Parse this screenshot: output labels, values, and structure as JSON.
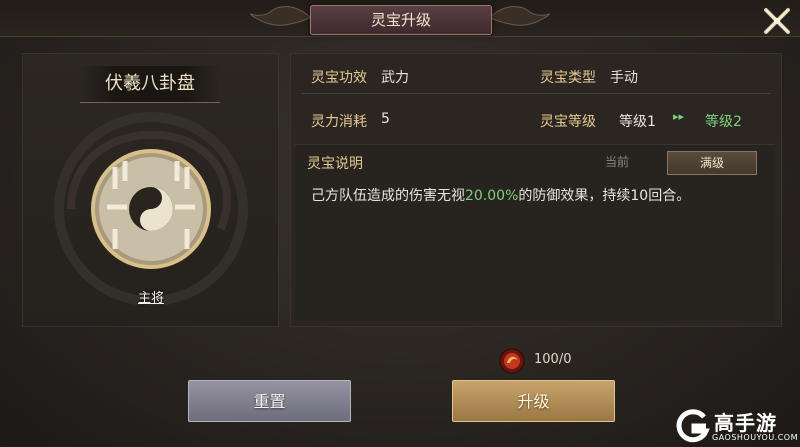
{
  "dialog": {
    "title": "灵宝升级",
    "close_icon": "close-x-icon"
  },
  "artifact": {
    "name": "伏羲八卦盘",
    "icon": "bagua-yin-yang-icon",
    "tag": "主将"
  },
  "attributes": {
    "effect_label": "灵宝功效",
    "effect_value": "武力",
    "type_label": "灵宝类型",
    "type_value": "手动",
    "cost_label": "灵力消耗",
    "cost_value": "5",
    "level_label": "灵宝等级",
    "level_current": "等级1",
    "level_arrow": "▸▸",
    "level_next": "等级2"
  },
  "description": {
    "label": "灵宝说明",
    "tab_current": "当前",
    "tab_max": "满级",
    "text_before": "己方队伍造成的伤害无视",
    "text_highlight": "20.00%",
    "text_after": "的防御效果，持续10回合。"
  },
  "upgrade_cost": {
    "icon": "red-spirit-orb-icon",
    "text": "100/0"
  },
  "buttons": {
    "reset": "重置",
    "upgrade": "升级"
  },
  "watermark": {
    "brand": "高手游",
    "sub": "GAOSHOUYOU.COM"
  },
  "colors": {
    "accent_gold": "#e6c991",
    "highlight_green": "#7fd07a",
    "upgrade_button": "#c8a46c",
    "reset_button": "#8f8d9b"
  }
}
